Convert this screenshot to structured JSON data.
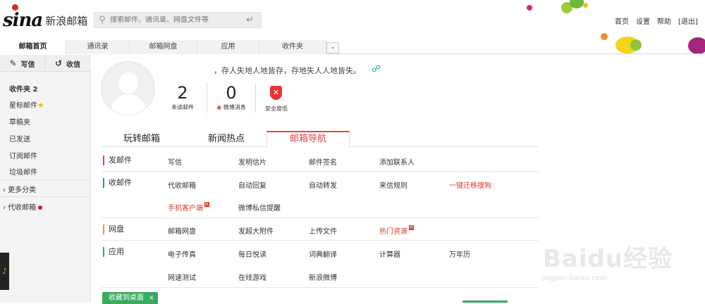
{
  "header": {
    "logo_text": "sina",
    "mail_name": "新浪邮箱",
    "search_placeholder": "搜索邮件、通讯录、网盘文件等",
    "links": [
      "首页",
      "设置",
      "帮助",
      "[退出]"
    ]
  },
  "nav": {
    "tabs": [
      "邮箱首页",
      "通讯录",
      "邮箱网盘",
      "应用",
      "收件夹"
    ],
    "active_index": 0
  },
  "sidebar": {
    "compose": "写信",
    "receive": "收信",
    "inbox": "收件夹 2",
    "items": [
      "星标邮件",
      "草稿夹",
      "已发送",
      "订阅邮件",
      "垃圾邮件"
    ],
    "more": "更多分类",
    "agent": "代收邮箱"
  },
  "profile": {
    "motto": "，存人失地人地皆存，存地失人人地皆失。",
    "stats": [
      {
        "num": "2",
        "label": "未读邮件"
      },
      {
        "num": "0",
        "label": "微博消息"
      },
      {
        "num": "",
        "label": "安全度低"
      }
    ]
  },
  "content_tabs": {
    "tabs": [
      "玩转邮箱",
      "新闻热点",
      "邮箱导航"
    ],
    "active_index": 2
  },
  "directory": {
    "send": {
      "title": "发邮件",
      "color": "#e04a2f",
      "links": [
        "写信",
        "发明信片",
        "邮件签名",
        "添加联系人"
      ]
    },
    "receive": {
      "title": "收邮件",
      "color": "#3a7fd1",
      "row1": [
        "代收邮箱",
        "自动回复",
        "自动转发",
        "来信规则",
        "一键迁移搜狗"
      ],
      "row2": [
        "手机客户端",
        "微博私信提醒"
      ]
    },
    "disk": {
      "title": "网盘",
      "color": "#f0a020",
      "links": [
        "邮箱网盘",
        "发超大附件",
        "上传文件",
        "热门资源"
      ]
    },
    "apps": {
      "title": "应用",
      "color": "#39a857",
      "row1": [
        "电子传真",
        "每日悦读",
        "词典翻译",
        "计算器",
        "万年历"
      ],
      "row2": [
        "网速测试",
        "在线游戏",
        "新浪微博"
      ]
    },
    "hot_badge": "H"
  },
  "footer": {
    "fav_button": "收藏到桌面",
    "close": "×"
  },
  "watermark": {
    "big": "Baidu经验",
    "small": "jingyan.baidu.com"
  },
  "icons": {
    "search": "search-icon",
    "enter": "enter-icon",
    "compose": "compose-icon",
    "receive": "refresh-icon",
    "share": "share-icon",
    "weibo": "weibo-icon",
    "shield": "shield-icon",
    "music": "music-icon"
  },
  "colors": {
    "accent_red": "#e8443d",
    "green": "#3aaa5d",
    "badge_red": "#e3141b"
  }
}
